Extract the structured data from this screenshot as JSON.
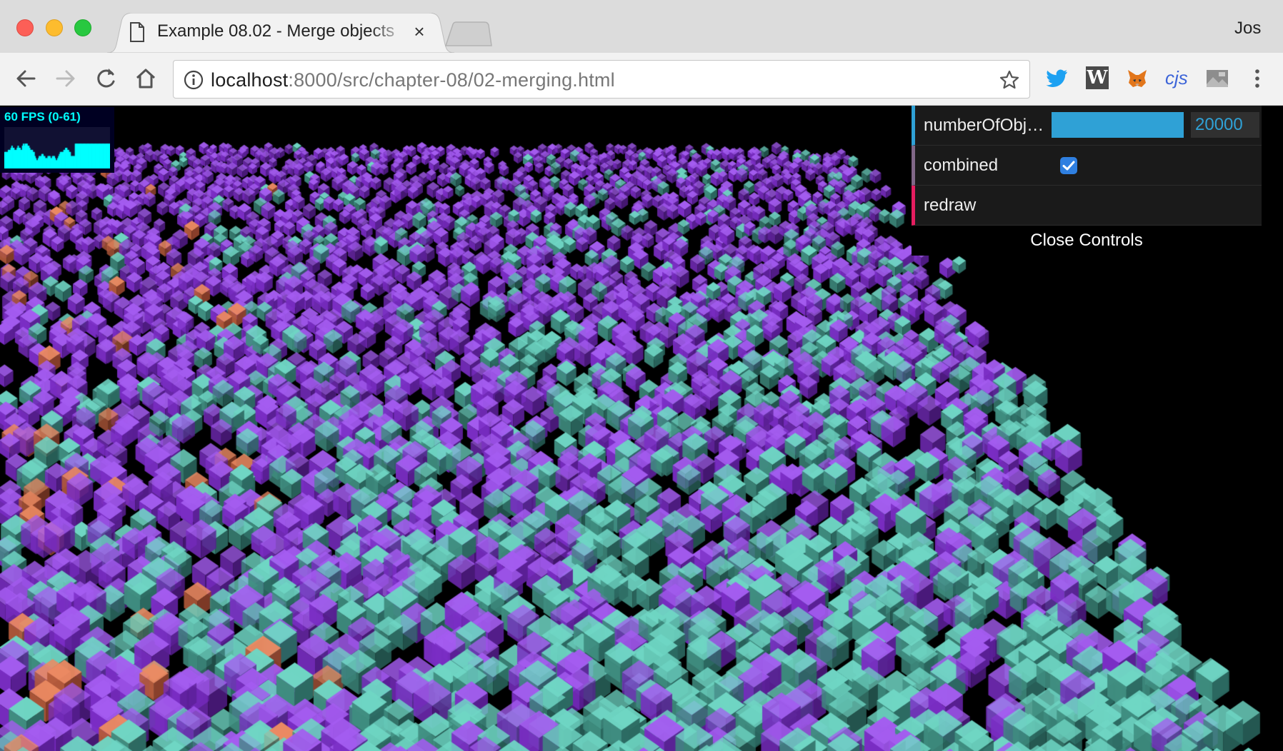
{
  "window": {
    "profile_name": "Jos"
  },
  "tab": {
    "title": "Example 08.02 - Merge objects",
    "close_glyph": "×",
    "doc_icon": "document-icon"
  },
  "toolbar": {
    "url_host": "localhost",
    "url_rest": ":8000/src/chapter-08/02-merging.html",
    "icons": [
      "back-icon",
      "forward-icon",
      "reload-icon",
      "home-icon",
      "info-icon",
      "star-icon"
    ],
    "extensions": {
      "twitter": "twitter-icon",
      "w_label": "W",
      "fox": "metamask-icon",
      "cjs_label": "cjs",
      "image": "image-extension-icon",
      "menu": "more-vert-icon"
    }
  },
  "stats": {
    "fps_text": "60 FPS (0-61)",
    "fps_history": [
      0.4,
      0.4,
      0.4,
      0.4,
      0.45,
      0.45,
      0.45,
      0.5,
      0.55,
      0.5,
      0.5,
      0.45,
      0.45,
      0.45,
      0.5,
      0.55,
      0.5,
      0.5,
      0.45,
      0.45,
      0.55,
      0.6,
      0.55,
      0.6,
      0.6,
      0.6,
      0.55,
      0.55,
      0.5,
      0.45,
      0.45,
      0.45,
      0.4,
      0.4,
      0.3,
      0.25,
      0.2,
      0.2,
      0.25,
      0.3,
      0.3,
      0.3,
      0.35,
      0.35,
      0.3,
      0.3,
      0.25,
      0.25,
      0.25,
      0.3,
      0.3,
      0.3,
      0.25,
      0.25,
      0.3,
      0.3,
      0.3,
      0.25,
      0.2,
      0.2,
      0.25,
      0.3,
      0.35,
      0.4,
      0.4,
      0.4,
      0.4,
      0.45,
      0.45,
      0.5,
      0.5,
      0.45,
      0.45,
      0.4,
      0.4,
      0.3,
      0.3,
      0.3,
      0.3,
      0.3,
      0.6,
      0.6,
      0.6,
      0.6,
      0.6,
      0.6,
      0.6,
      0.6,
      0.6,
      0.6,
      0.6,
      0.6,
      0.6,
      0.6,
      0.6,
      0.6,
      0.6,
      0.6,
      0.6,
      0.6,
      0.6,
      0.6,
      0.6,
      0.6,
      0.6,
      0.6,
      0.6,
      0.6,
      0.6,
      0.6,
      0.6,
      0.6,
      0.6,
      0.6,
      0.6,
      0.6,
      0.6,
      0.6,
      0.6,
      0.6
    ],
    "color": "#00ffff"
  },
  "gui": {
    "number_label": "numberOfObje…",
    "number_value": "20000",
    "number_fraction": 1.0,
    "combined_label": "combined",
    "combined_checked": true,
    "redraw_label": "redraw",
    "close_label": "Close Controls"
  },
  "scene": {
    "colors": {
      "purple_top": "#a45cf0",
      "purple_left": "#7a2dc4",
      "purple_right": "#5a1f95",
      "teal_top": "#6fd6c4",
      "teal_left": "#3f8d80",
      "teal_right": "#2c6a62",
      "orange_top": "#ec8a62",
      "orange_left": "#b45a3b",
      "orange_right": "#8c402b",
      "background": "#000000"
    }
  }
}
